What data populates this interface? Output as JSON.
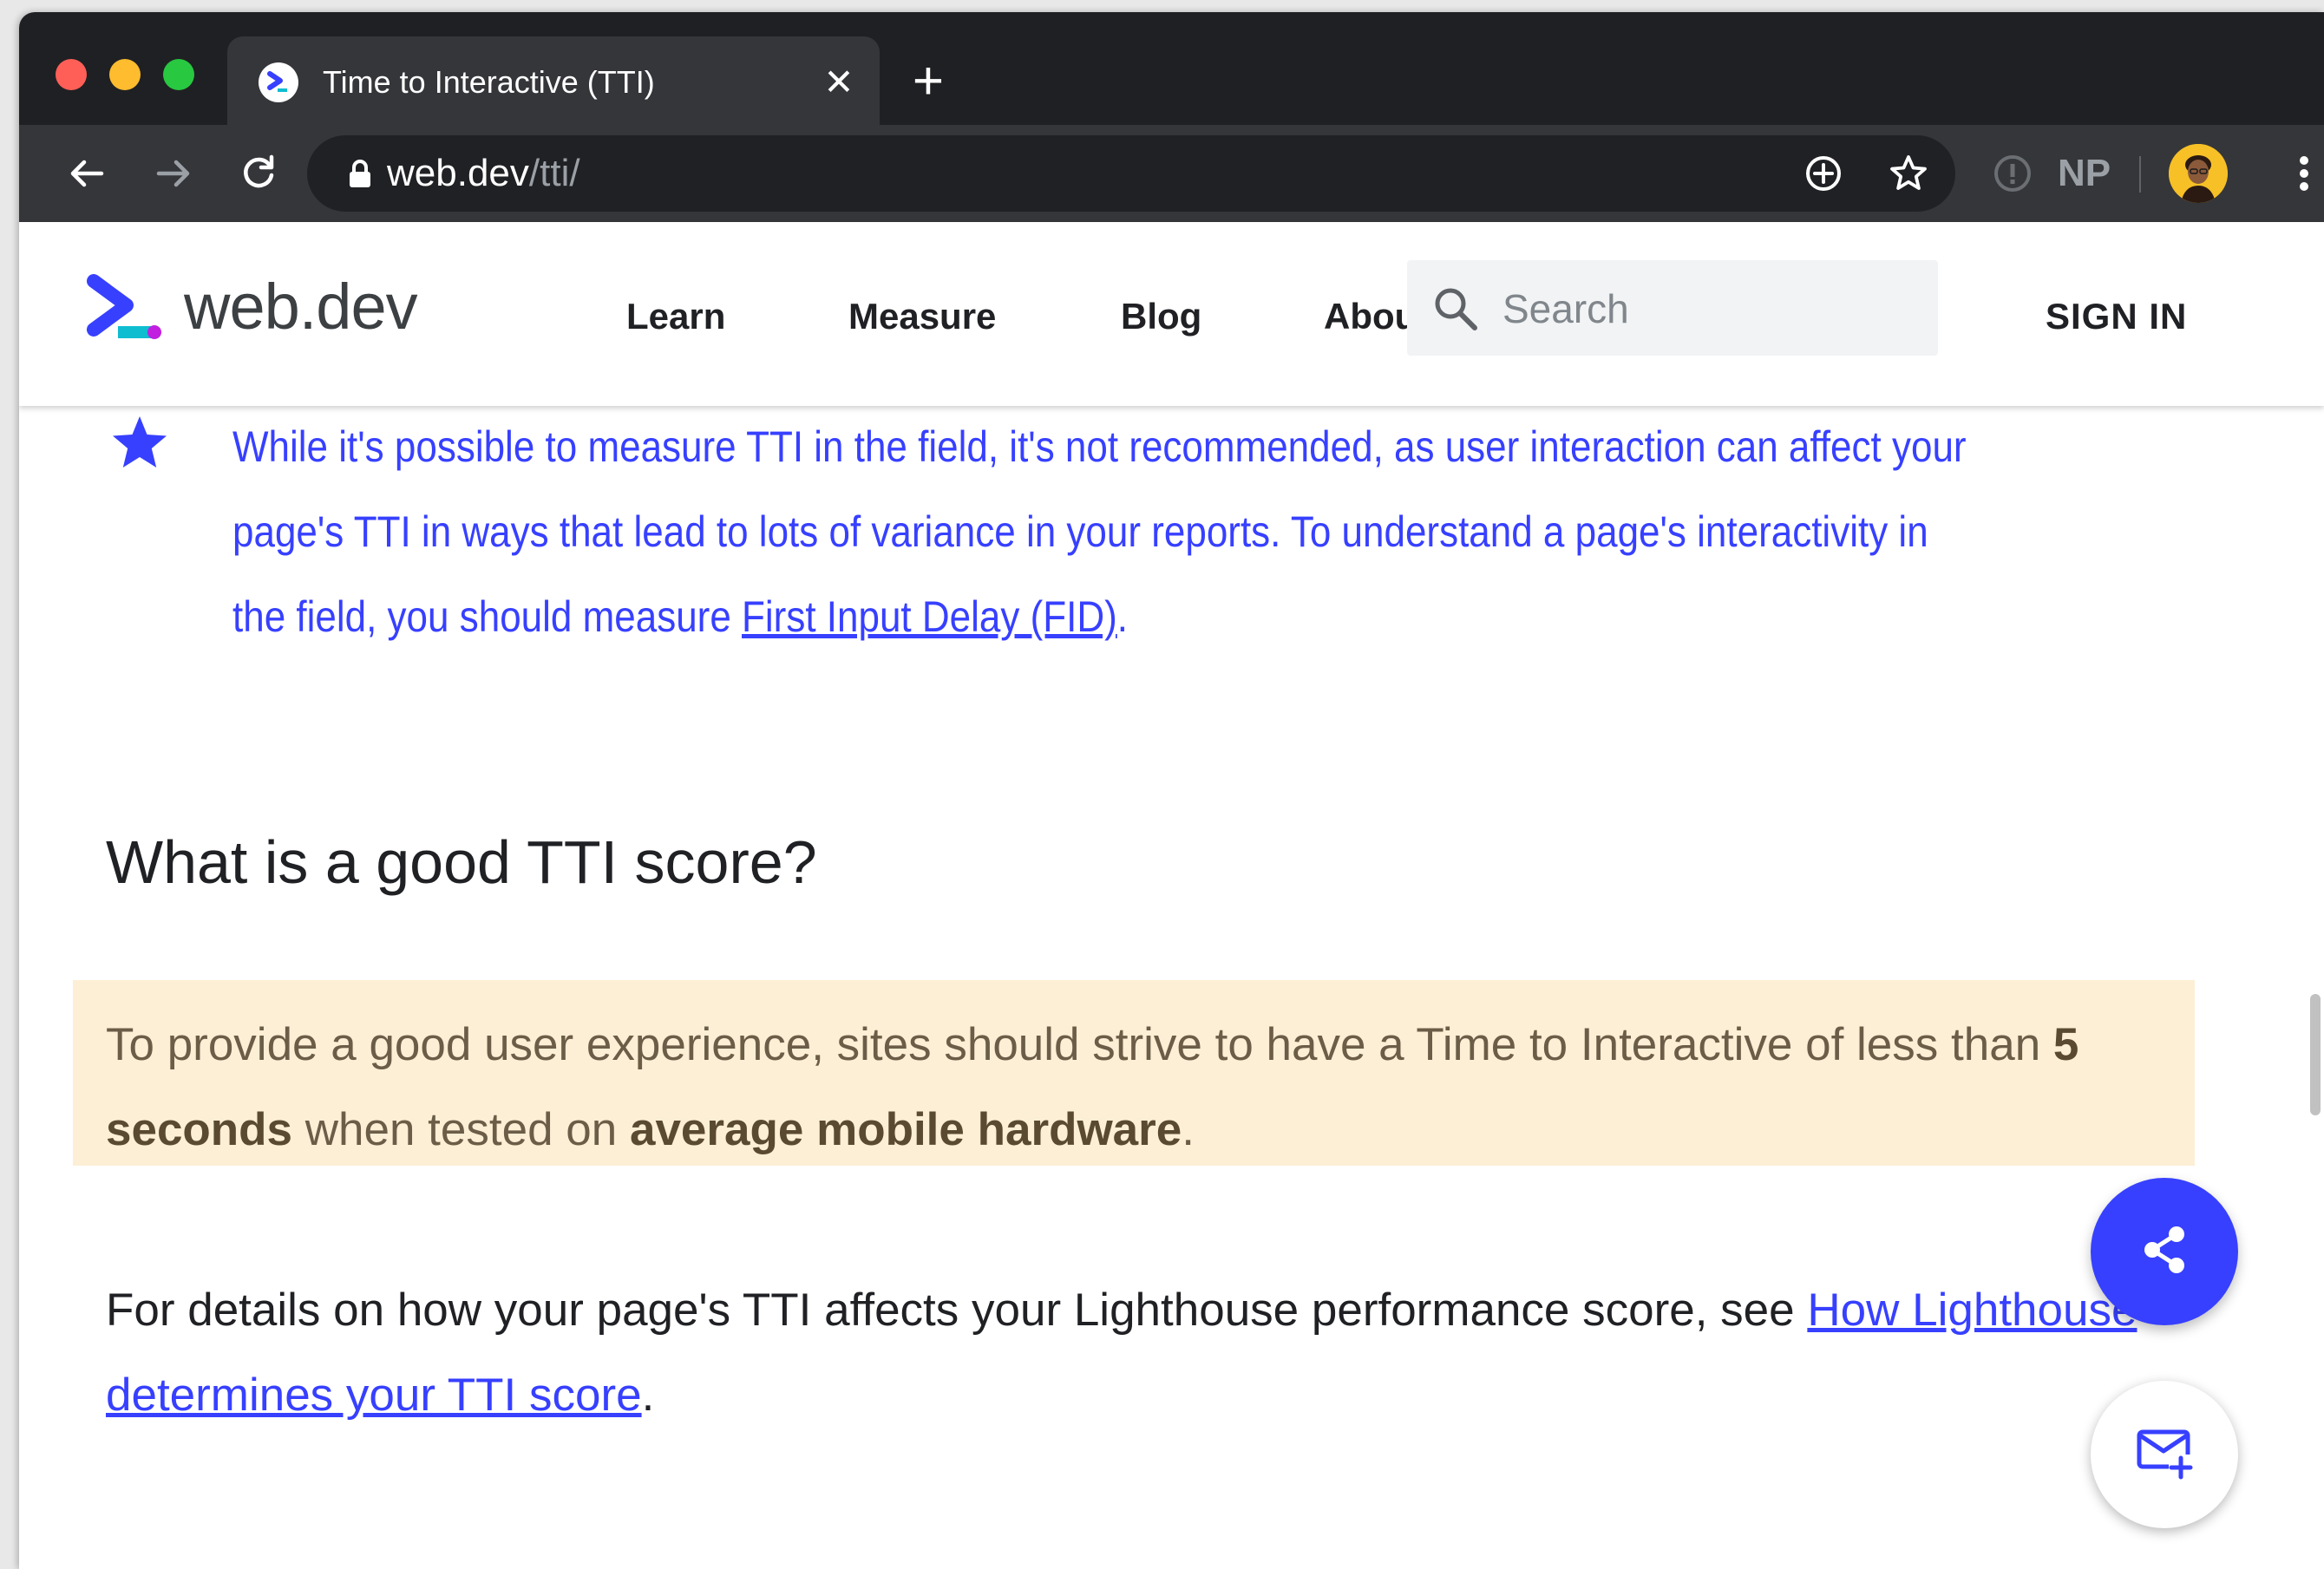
{
  "browser": {
    "tab_title": "Time to Interactive (TTI)",
    "tab_close": "✕",
    "new_tab": "+",
    "url_host": "web.dev",
    "url_path": "/tti/",
    "extension_label": "NP"
  },
  "site": {
    "logo_text": "web.dev",
    "nav": [
      "Learn",
      "Measure",
      "Blog",
      "About"
    ],
    "search_placeholder": "Search",
    "sign_in": "SIGN IN"
  },
  "content": {
    "note_text": "While it's possible to measure TTI in the field, it's not recommended, as user interaction can affect your page's TTI in ways that lead to lots of variance in your reports. To understand a page's interactivity in the field, you should measure ",
    "note_link": "First Input Delay (FID)",
    "note_end": ".",
    "heading": "What is a good TTI score?",
    "callout_pre": "To provide a good user experience, sites should strive to have a Time to Interactive of less than ",
    "callout_bold1": "5 seconds",
    "callout_mid": " when tested on ",
    "callout_bold2": "average mobile hardware",
    "callout_end": ".",
    "para_pre": "For details on how your page's TTI affects your Lighthouse performance score, see ",
    "para_link": "How Lighthouse determines your TTI score",
    "para_end": "."
  },
  "colors": {
    "accent": "#3740ff",
    "callout_bg": "#fcefd5",
    "chrome_dark": "#35363a"
  },
  "icons": [
    "webdev-favicon",
    "close-icon",
    "plus-icon",
    "back-arrow-icon",
    "forward-arrow-icon",
    "reload-icon",
    "lock-icon",
    "install-icon",
    "bookmark-star-icon",
    "info-icon",
    "avatar",
    "more-vert-icon",
    "search-icon",
    "star-icon",
    "share-icon",
    "mail-add-icon"
  ]
}
